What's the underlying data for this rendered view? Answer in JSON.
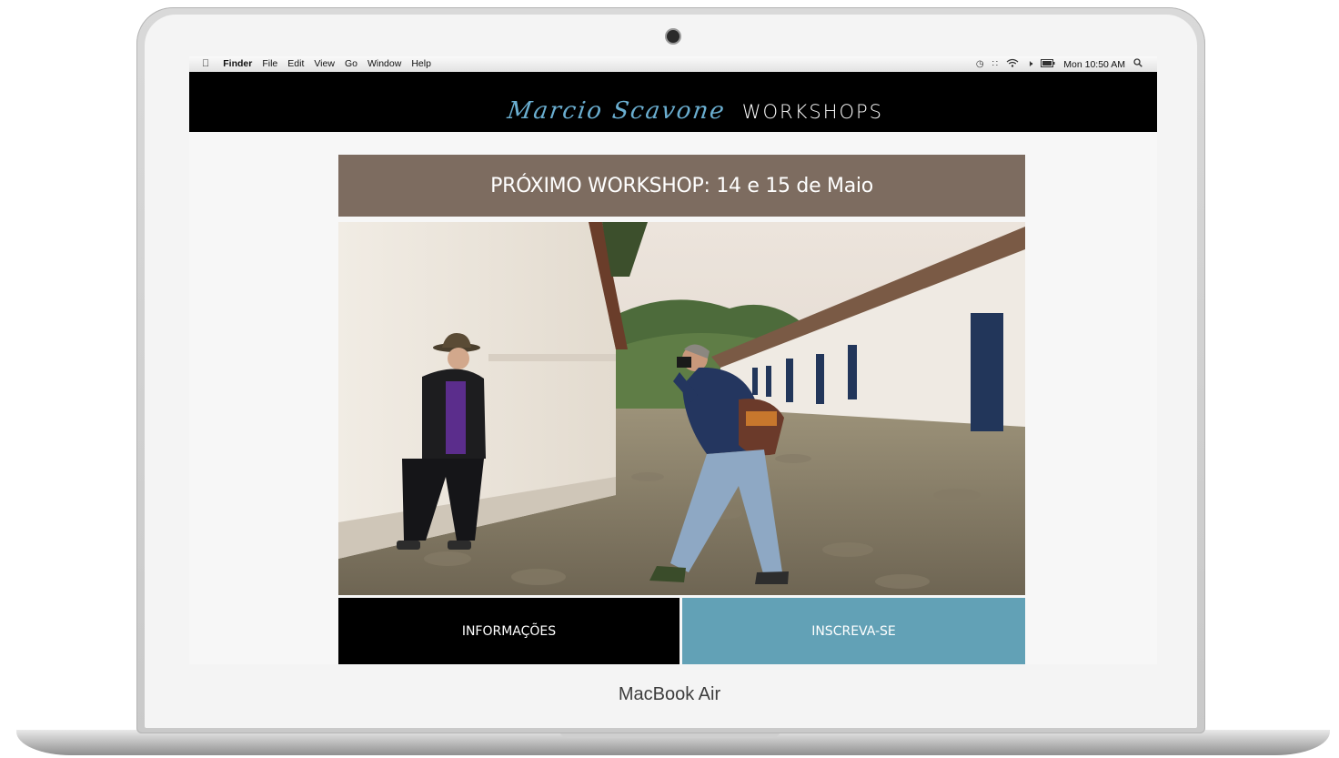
{
  "device": {
    "label": "MacBook Air"
  },
  "menubar": {
    "app": "Finder",
    "items": [
      "File",
      "Edit",
      "View",
      "Go",
      "Window",
      "Help"
    ],
    "clock": "Mon 10:50 AM",
    "status_icons": [
      "time-machine-icon",
      "bluetooth-icon",
      "wifi-icon",
      "volume-icon",
      "battery-icon",
      "spotlight-search-icon"
    ]
  },
  "site": {
    "logo_script": "Marcio Scavone",
    "logo_word": "WORKSHOPS",
    "next_workshop": "PRÓXIMO WORKSHOP: 14 e 15 de Maio",
    "buttons": {
      "info": "INFORMAÇÕES",
      "signup": "INSCREVA-SE"
    }
  },
  "colors": {
    "header_bg": "#000000",
    "banner_bg": "#7d6c60",
    "logo_accent": "#6aaed0",
    "signup_bg": "#62a1b6"
  }
}
